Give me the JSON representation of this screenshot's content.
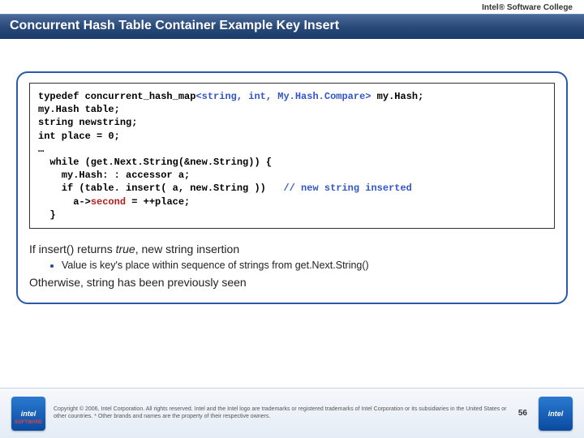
{
  "header": {
    "label": "Intel® Software College"
  },
  "title": "Concurrent Hash Table Container Example Key Insert",
  "code": {
    "line1a": "typedef concurrent_hash_map",
    "line1b": "<string, int, My.Hash.Compare>",
    "line1c": " my.Hash;",
    "line2": "my.Hash table;",
    "line3": "string newstring;",
    "line4": "int place = 0;",
    "line5": "…",
    "line6": "  while (get.Next.String(&new.String)) {",
    "line7": "    my.Hash: : accessor a;",
    "line8a": "    if (table. insert( a, new.String ))   ",
    "line8b": "// new string inserted",
    "line9a": "      a->",
    "line9b": "second",
    "line9c": " = ++place;",
    "line10": "  }"
  },
  "explain": {
    "p1a": "If insert() returns ",
    "p1b": "true",
    "p1c": ", new string insertion",
    "bullet": "Value is key's place within sequence of strings from get.Next.String()",
    "p2": "Otherwise, string has been previously seen"
  },
  "footer": {
    "logo_text": "intel",
    "logo_sw": "SOFTWARE",
    "copyright": "Copyright © 2006, Intel Corporation. All rights reserved.\nIntel and the Intel logo are trademarks or registered trademarks of Intel Corporation or its subsidiaries in the United States or other countries. * Other brands and names are the property of their respective owners.",
    "page": "56"
  }
}
